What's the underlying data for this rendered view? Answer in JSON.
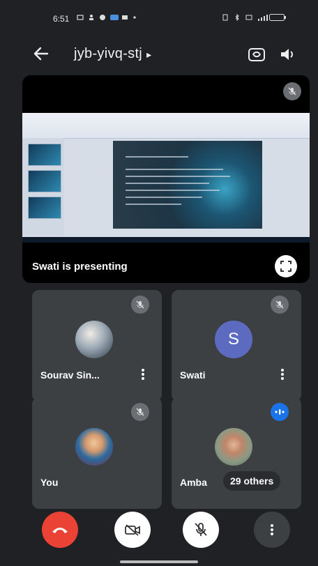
{
  "status_bar": {
    "time": "6:51"
  },
  "header": {
    "meeting_code": "jyb-yivq-stj",
    "caret": "▸"
  },
  "presentation": {
    "label": "Swati is presenting",
    "muted": true
  },
  "participants": [
    {
      "name": "Sourav Sin...",
      "muted": true,
      "avatar": "photo"
    },
    {
      "name": "Swati",
      "muted": true,
      "avatar": "initial",
      "initial": "S",
      "avatar_color": "#5c6bc0"
    },
    {
      "name": "You",
      "muted": true,
      "avatar": "photo"
    },
    {
      "name": "Amba",
      "speaking": true,
      "avatar": "photo",
      "others_label": "29 others"
    }
  ],
  "controls": [
    {
      "name": "end-call",
      "icon": "phone-hangup-icon",
      "color": "#ea4335"
    },
    {
      "name": "camera-off",
      "icon": "video-off-icon",
      "color": "#ffffff"
    },
    {
      "name": "mic-off",
      "icon": "mic-off-icon",
      "color": "#ffffff"
    },
    {
      "name": "more-options",
      "icon": "more-vert-icon",
      "color": "#3c4043"
    }
  ],
  "colors": {
    "background": "#1f2124",
    "tile": "#3c4043",
    "accent_blue": "#1a73e8",
    "end_call_red": "#ea4335"
  }
}
